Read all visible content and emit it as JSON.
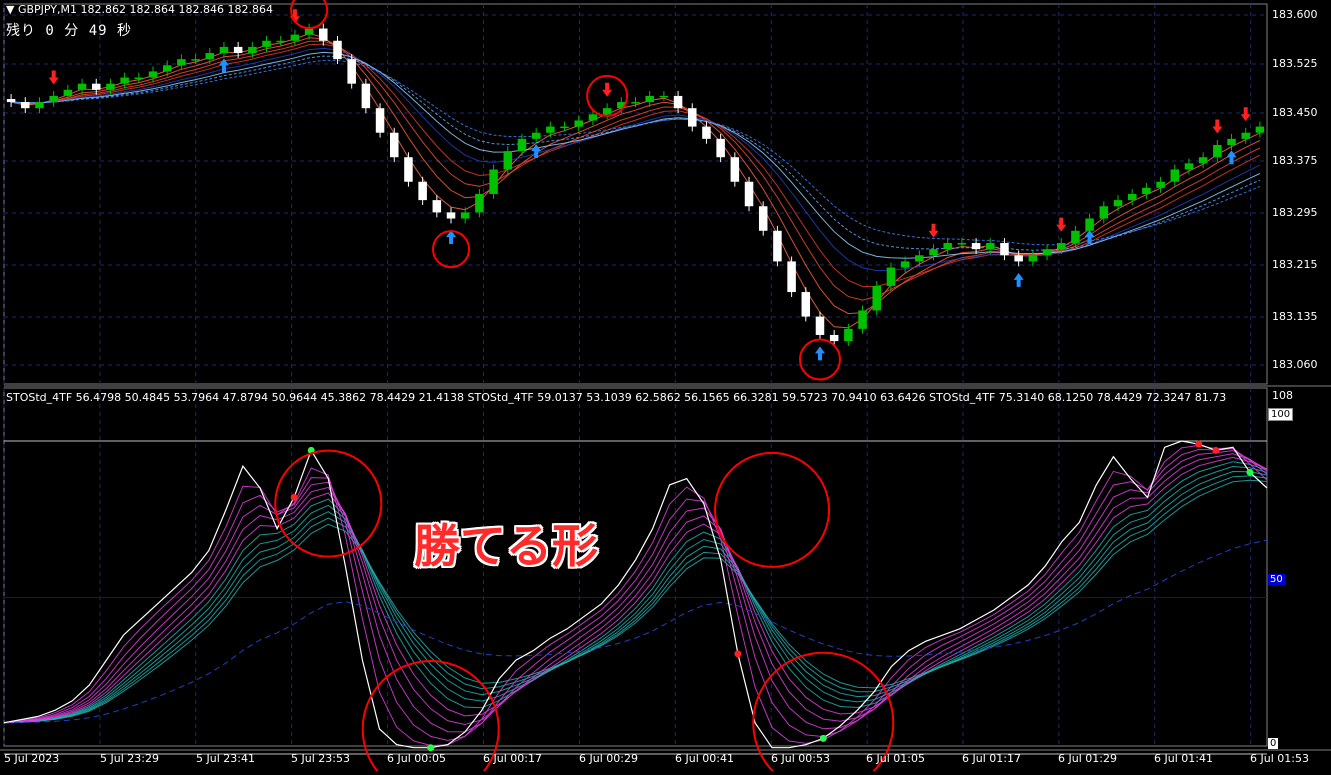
{
  "window": {
    "symbol_title": "▼ GBPJPY,M1  182.862 182.864 182.846 182.864",
    "countdown": "残り 0 分 49 秒"
  },
  "price_axis": {
    "labels": [
      "183.600",
      "183.525",
      "183.450",
      "183.375",
      "183.295",
      "183.215",
      "183.135",
      "183.060"
    ]
  },
  "time_axis": {
    "labels": [
      "5 Jul 2023",
      "5 Jul 23:29",
      "5 Jul 23:41",
      "5 Jul 23:53",
      "6 Jul 00:05",
      "6 Jul 00:17",
      "6 Jul 00:29",
      "6 Jul 00:41",
      "6 Jul 00:53",
      "6 Jul 01:05",
      "6 Jul 01:17",
      "6 Jul 01:29",
      "6 Jul 01:41",
      "6 Jul 01:53"
    ]
  },
  "oscillator": {
    "title": "STOStd_4TF 56.4798 50.4845 53.7964 47.8794 50.9644 45.3862 78.4429 21.4138  STOStd_4TF 59.0137 53.1039 62.5862 56.1565 66.3281 59.5723 70.9410 63.6426  STOStd_4TF 75.3140 68.1250 78.4429 72.3247 81.73",
    "scale_top": "108",
    "level_100": "100",
    "level_50": "50",
    "level_0": "0"
  },
  "annotation": {
    "caption": "勝てる形"
  },
  "colors": {
    "background": "#000000",
    "grid": "#1e2a6e",
    "bull_candle": "#00c000",
    "bear_candle": "#ffffff",
    "sell_arrow": "#ff2020",
    "buy_arrow": "#1e90ff",
    "circle": "#ff0000",
    "osc_main": "#ffffff",
    "osc_magenta": "#e040e0",
    "osc_teal": "#20b0b0",
    "osc_slow": "#2040c0",
    "level_50_line": "#0000ff"
  },
  "chart_data": [
    {
      "type": "candlestick",
      "title": "GBPJPY,M1",
      "ylim": [
        183.02,
        183.64
      ],
      "series": [
        {
          "close": [
            183.48,
            183.47,
            183.48,
            183.49,
            183.5,
            183.51,
            183.5,
            183.51,
            183.52,
            183.52,
            183.53,
            183.54,
            183.55,
            183.55,
            183.56,
            183.57,
            183.56,
            183.57,
            183.58,
            183.58,
            183.59,
            183.6,
            183.58,
            183.55,
            183.51,
            183.47,
            183.43,
            183.39,
            183.35,
            183.32,
            183.3,
            183.29,
            183.3,
            183.33,
            183.37,
            183.4,
            183.42,
            183.43,
            183.44,
            183.44,
            183.45,
            183.46,
            183.47,
            183.48,
            183.48,
            183.49,
            183.49,
            183.47,
            183.44,
            183.42,
            183.39,
            183.35,
            183.31,
            183.27,
            183.22,
            183.17,
            183.13,
            183.1,
            183.09,
            183.11,
            183.14,
            183.18,
            183.21,
            183.22,
            183.23,
            183.24,
            183.25,
            183.25,
            183.24,
            183.25,
            183.23,
            183.22,
            183.23,
            183.24,
            183.25,
            183.27,
            183.29,
            183.31,
            183.32,
            183.33,
            183.34,
            183.35,
            183.37,
            183.38,
            183.39,
            183.41,
            183.42,
            183.43,
            183.44
          ],
          "buy_arrows": [
            15,
            31,
            37,
            57,
            71,
            76,
            86
          ],
          "sell_arrows": [
            3,
            20,
            42,
            65,
            74,
            85,
            87
          ]
        }
      ]
    },
    {
      "type": "line",
      "title": "STOStd_4TF",
      "ylim": [
        0,
        108
      ],
      "series": [
        {
          "name": "STOStd_4TF",
          "values": [
            10,
            11,
            12,
            14,
            17,
            22,
            30,
            38,
            43,
            48,
            53,
            58,
            65,
            78,
            92,
            85,
            72,
            82,
            97,
            88,
            60,
            30,
            8,
            3,
            2,
            2,
            3,
            7,
            14,
            24,
            30,
            33,
            37,
            40,
            44,
            48,
            54,
            62,
            72,
            86,
            88,
            80,
            62,
            32,
            10,
            2,
            2,
            3,
            5,
            9,
            14,
            20,
            28,
            33,
            36,
            38,
            40,
            43,
            46,
            50,
            54,
            60,
            68,
            74,
            86,
            95,
            88,
            82,
            98,
            100,
            99,
            97,
            98,
            90,
            85
          ]
        }
      ],
      "levels": [
        0,
        50,
        100
      ]
    }
  ]
}
